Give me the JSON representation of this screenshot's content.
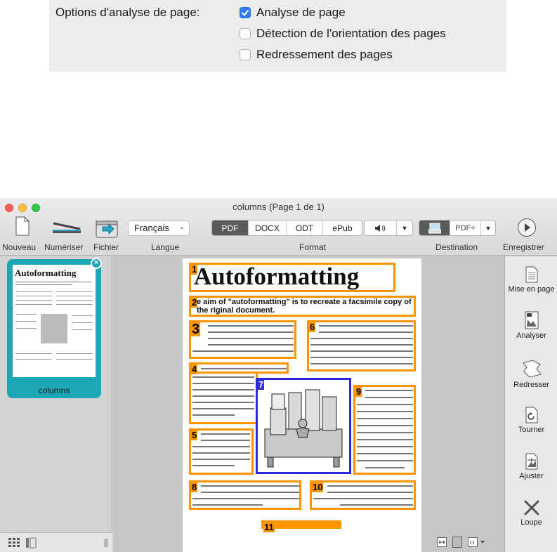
{
  "options": {
    "label": "Options d'analyse de page:",
    "items": [
      {
        "label": "Analyse de page",
        "checked": true
      },
      {
        "label": "Détection de l'orientation des pages",
        "checked": false
      },
      {
        "label": "Redressement des pages",
        "checked": false
      }
    ]
  },
  "window": {
    "title": "columns (Page 1 de 1)",
    "toolbar": {
      "new_label": "Nouveau",
      "scan_label": "Numériser",
      "file_label": "Fichier",
      "language_value": "Français",
      "language_label": "Langue",
      "formats": [
        "PDF",
        "DOCX",
        "ODT",
        "ePub"
      ],
      "active_format": "PDF",
      "format_label": "Format",
      "destination_value": "PDF+",
      "destination_label": "Destination",
      "save_label": "Enregistrer"
    },
    "sidebar": {
      "thumb_title": "Autoformatting",
      "thumb_caption": "columns"
    },
    "document": {
      "heading": "Autoformatting",
      "subheading": "e aim of \"autoformatting\" is to recreate a facsimile copy of the riginal document.",
      "block_numbers": [
        "1",
        "2",
        "3",
        "4",
        "5",
        "6",
        "7",
        "8",
        "9",
        "10",
        "11"
      ]
    },
    "right_tools": [
      {
        "label": "Mise en page",
        "icon": "page-layout-icon"
      },
      {
        "label": "Analyser",
        "icon": "analyze-icon"
      },
      {
        "label": "Redresser",
        "icon": "straighten-icon"
      },
      {
        "label": "Tourner",
        "icon": "rotate-icon"
      },
      {
        "label": "Ajuster",
        "icon": "adjust-icon"
      },
      {
        "label": "Loupe",
        "icon": "magnifier-icon"
      }
    ],
    "colors": {
      "accent": "#1ba7b6",
      "block": "#ff9500",
      "image_block": "#2d2bd8"
    }
  }
}
